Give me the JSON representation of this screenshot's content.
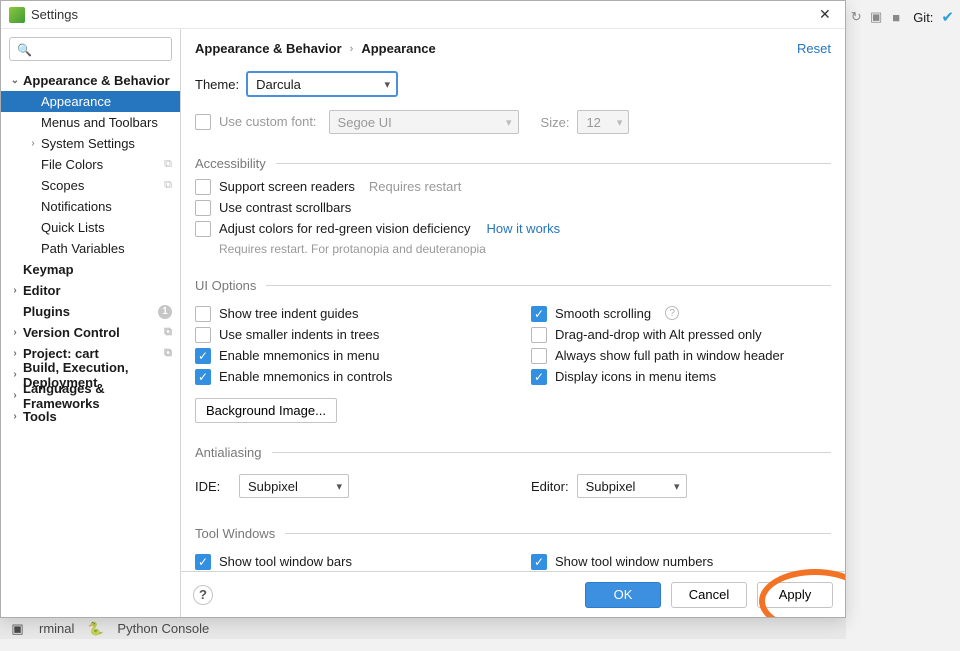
{
  "bg": {
    "git_label": "Git:"
  },
  "dialog": {
    "title": "Settings",
    "search_placeholder": "",
    "breadcrumb": {
      "a": "Appearance & Behavior",
      "b": "Appearance"
    },
    "reset": "Reset",
    "footer": {
      "ok": "OK",
      "cancel": "Cancel",
      "apply": "Apply"
    }
  },
  "tree": [
    {
      "label": "Appearance & Behavior",
      "depth": 0,
      "exp": "v",
      "bold": true
    },
    {
      "label": "Appearance",
      "depth": 1,
      "selected": true
    },
    {
      "label": "Menus and Toolbars",
      "depth": 1
    },
    {
      "label": "System Settings",
      "depth": 1,
      "exp": ">"
    },
    {
      "label": "File Colors",
      "depth": 1,
      "overlay": true
    },
    {
      "label": "Scopes",
      "depth": 1,
      "overlay": true
    },
    {
      "label": "Notifications",
      "depth": 1
    },
    {
      "label": "Quick Lists",
      "depth": 1
    },
    {
      "label": "Path Variables",
      "depth": 1
    },
    {
      "label": "Keymap",
      "depth": 0,
      "bold": true
    },
    {
      "label": "Editor",
      "depth": 0,
      "exp": ">",
      "bold": true
    },
    {
      "label": "Plugins",
      "depth": 0,
      "bold": true,
      "badge": "1"
    },
    {
      "label": "Version Control",
      "depth": 0,
      "exp": ">",
      "bold": true,
      "overlay": true
    },
    {
      "label": "Project: cart",
      "depth": 0,
      "exp": ">",
      "bold": true,
      "overlay": true
    },
    {
      "label": "Build, Execution, Deployment",
      "depth": 0,
      "exp": ">",
      "bold": true
    },
    {
      "label": "Languages & Frameworks",
      "depth": 0,
      "exp": ">",
      "bold": true
    },
    {
      "label": "Tools",
      "depth": 0,
      "exp": ">",
      "bold": true
    }
  ],
  "theme": {
    "label": "Theme:",
    "value": "Darcula"
  },
  "font": {
    "check": "Use custom font:",
    "value": "Segoe UI",
    "size_label": "Size:",
    "size": "12"
  },
  "sections": {
    "accessibility": {
      "title": "Accessibility",
      "screen_readers": "Support screen readers",
      "screen_readers_hint": "Requires restart",
      "contrast": "Use contrast scrollbars",
      "colorblind": "Adjust colors for red-green vision deficiency",
      "colorblind_link": "How it works",
      "colorblind_sub": "Requires restart. For protanopia and deuteranopia"
    },
    "ui": {
      "title": "UI Options",
      "left": [
        {
          "label": "Show tree indent guides",
          "checked": false
        },
        {
          "label": "Use smaller indents in trees",
          "checked": false
        },
        {
          "label": "Enable mnemonics in menu",
          "checked": true
        },
        {
          "label": "Enable mnemonics in controls",
          "checked": true
        }
      ],
      "right": [
        {
          "label": "Smooth scrolling",
          "checked": true,
          "help": true
        },
        {
          "label": "Drag-and-drop with Alt pressed only",
          "checked": false
        },
        {
          "label": "Always show full path in window header",
          "checked": false
        },
        {
          "label": "Display icons in menu items",
          "checked": true
        }
      ],
      "bg_image_btn": "Background Image..."
    },
    "aa": {
      "title": "Antialiasing",
      "ide": "IDE:",
      "ide_value": "Subpixel",
      "editor": "Editor:",
      "editor_value": "Subpixel"
    },
    "tool": {
      "title": "Tool Windows",
      "bars": "Show tool window bars",
      "numbers": "Show tool window numbers"
    }
  },
  "bottom_tabs": {
    "terminal": "rminal",
    "console": "Python Console"
  }
}
